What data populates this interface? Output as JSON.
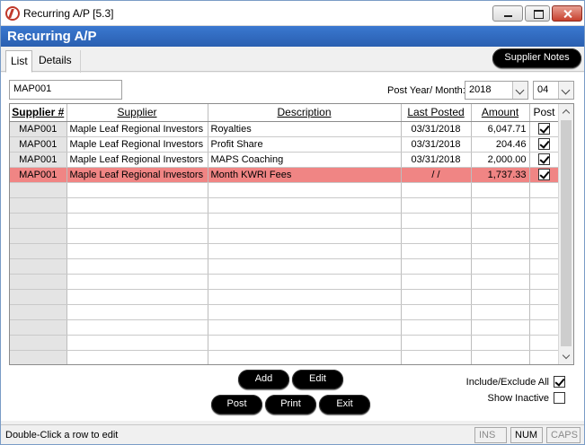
{
  "window": {
    "title": "Recurring A/P [5.3]"
  },
  "banner": {
    "title": "Recurring A/P"
  },
  "tabs": [
    {
      "label": "List"
    },
    {
      "label": "Details"
    }
  ],
  "supplier_notes_label": "Supplier Notes",
  "filter": {
    "supplier_value": "MAP001",
    "post_label": "Post Year/ Month:",
    "year": "2018",
    "month": "04"
  },
  "columns": [
    "Supplier #",
    "Supplier",
    "Description",
    "Last Posted",
    "Amount",
    "Post"
  ],
  "rows": [
    {
      "supplier_no": "MAP001",
      "supplier": "Maple Leaf Regional Investors",
      "description": "Royalties",
      "last_posted": "03/31/2018",
      "amount": "6,047.71",
      "post": true
    },
    {
      "supplier_no": "MAP001",
      "supplier": "Maple Leaf Regional Investors",
      "description": "Profit Share",
      "last_posted": "03/31/2018",
      "amount": "204.46",
      "post": true
    },
    {
      "supplier_no": "MAP001",
      "supplier": "Maple Leaf Regional Investors",
      "description": "MAPS Coaching",
      "last_posted": "03/31/2018",
      "amount": "2,000.00",
      "post": true
    },
    {
      "supplier_no": "MAP001",
      "supplier": "Maple Leaf Regional Investors",
      "description": "Month KWRI Fees",
      "last_posted": " /  /",
      "amount": "1,737.33",
      "post": true,
      "selected": true
    }
  ],
  "buttons": {
    "add": "Add",
    "edit": "Edit",
    "post": "Post",
    "print": "Print",
    "exit": "Exit"
  },
  "options": {
    "include_exclude_label": "Include/Exclude All",
    "include_exclude_checked": true,
    "show_inactive_label": "Show Inactive",
    "show_inactive_checked": false
  },
  "statusbar": {
    "text": "Double-Click a row to edit",
    "indicators": [
      {
        "label": "INS",
        "on": false
      },
      {
        "label": "NUM",
        "on": true
      },
      {
        "label": "CAPS",
        "on": false
      }
    ]
  },
  "colors": {
    "banner": "#2a5fb0",
    "selected_row": "#f08584",
    "button": "#000000"
  }
}
